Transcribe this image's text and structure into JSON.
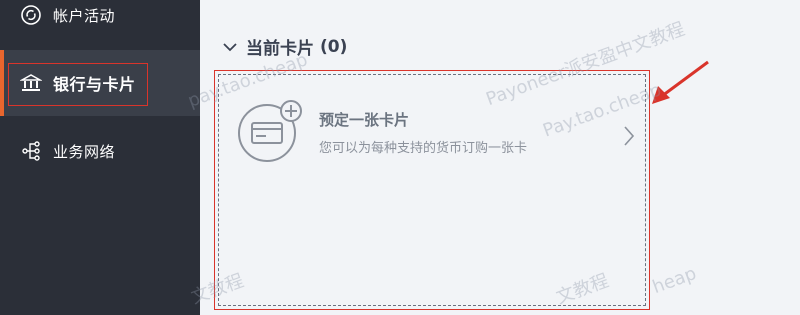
{
  "sidebar": {
    "items": [
      {
        "label": "帐户活动",
        "icon": "refresh-circle-icon"
      },
      {
        "label": "银行与卡片",
        "icon": "bank-icon"
      },
      {
        "label": "业务网络",
        "icon": "network-icon"
      }
    ]
  },
  "main": {
    "section_title": "当前卡片",
    "section_count": "(0)",
    "card": {
      "title": "预定一张卡片",
      "subtitle": "您可以为每种支持的货币订购一张卡",
      "icon": "add-card-icon"
    }
  },
  "watermarks": [
    "pay.tao.cheap",
    "Payoneer派安盈中文教程",
    "Pay.tao.cheap",
    "文教程",
    "文教程",
    "heap"
  ],
  "colors": {
    "sidebar_bg": "#2b2f38",
    "active_bg": "#3a3f49",
    "accent": "#e8662e",
    "annotation_red": "#d9342b",
    "main_bg": "#f2f4f7"
  }
}
